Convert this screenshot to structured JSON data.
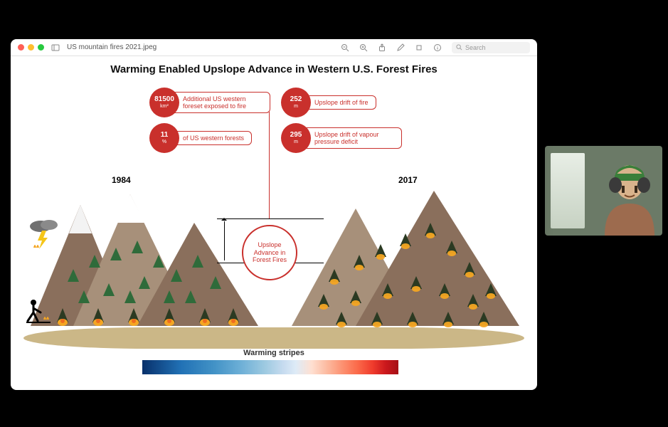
{
  "window": {
    "filename": "US mountain fires 2021.jpeg",
    "search_placeholder": "Search"
  },
  "slide": {
    "title": "Warming Enabled Upslope Advance in Western U.S. Forest Fires",
    "year_left": "1984",
    "year_right": "2017",
    "center_callout": "Upslope Advance in Forest Fires",
    "stripes_label": "Warming stripes"
  },
  "stats": {
    "top_left": {
      "value": "81500",
      "unit": "km²",
      "text": "Additional US western foreset exposed to fire"
    },
    "bot_left": {
      "value": "11",
      "unit": "%",
      "text": "of US western forests"
    },
    "top_right": {
      "value": "252",
      "unit": "m",
      "text": "Upslope drift of fire"
    },
    "bot_right": {
      "value": "295",
      "unit": "m",
      "text": "Upslope drift of vapour pressure deficit"
    }
  },
  "colors": {
    "accent": "#c9302c",
    "mountain_dark": "#8a6f5c",
    "mountain_light": "#a7907a",
    "ground": "#cbb787"
  }
}
